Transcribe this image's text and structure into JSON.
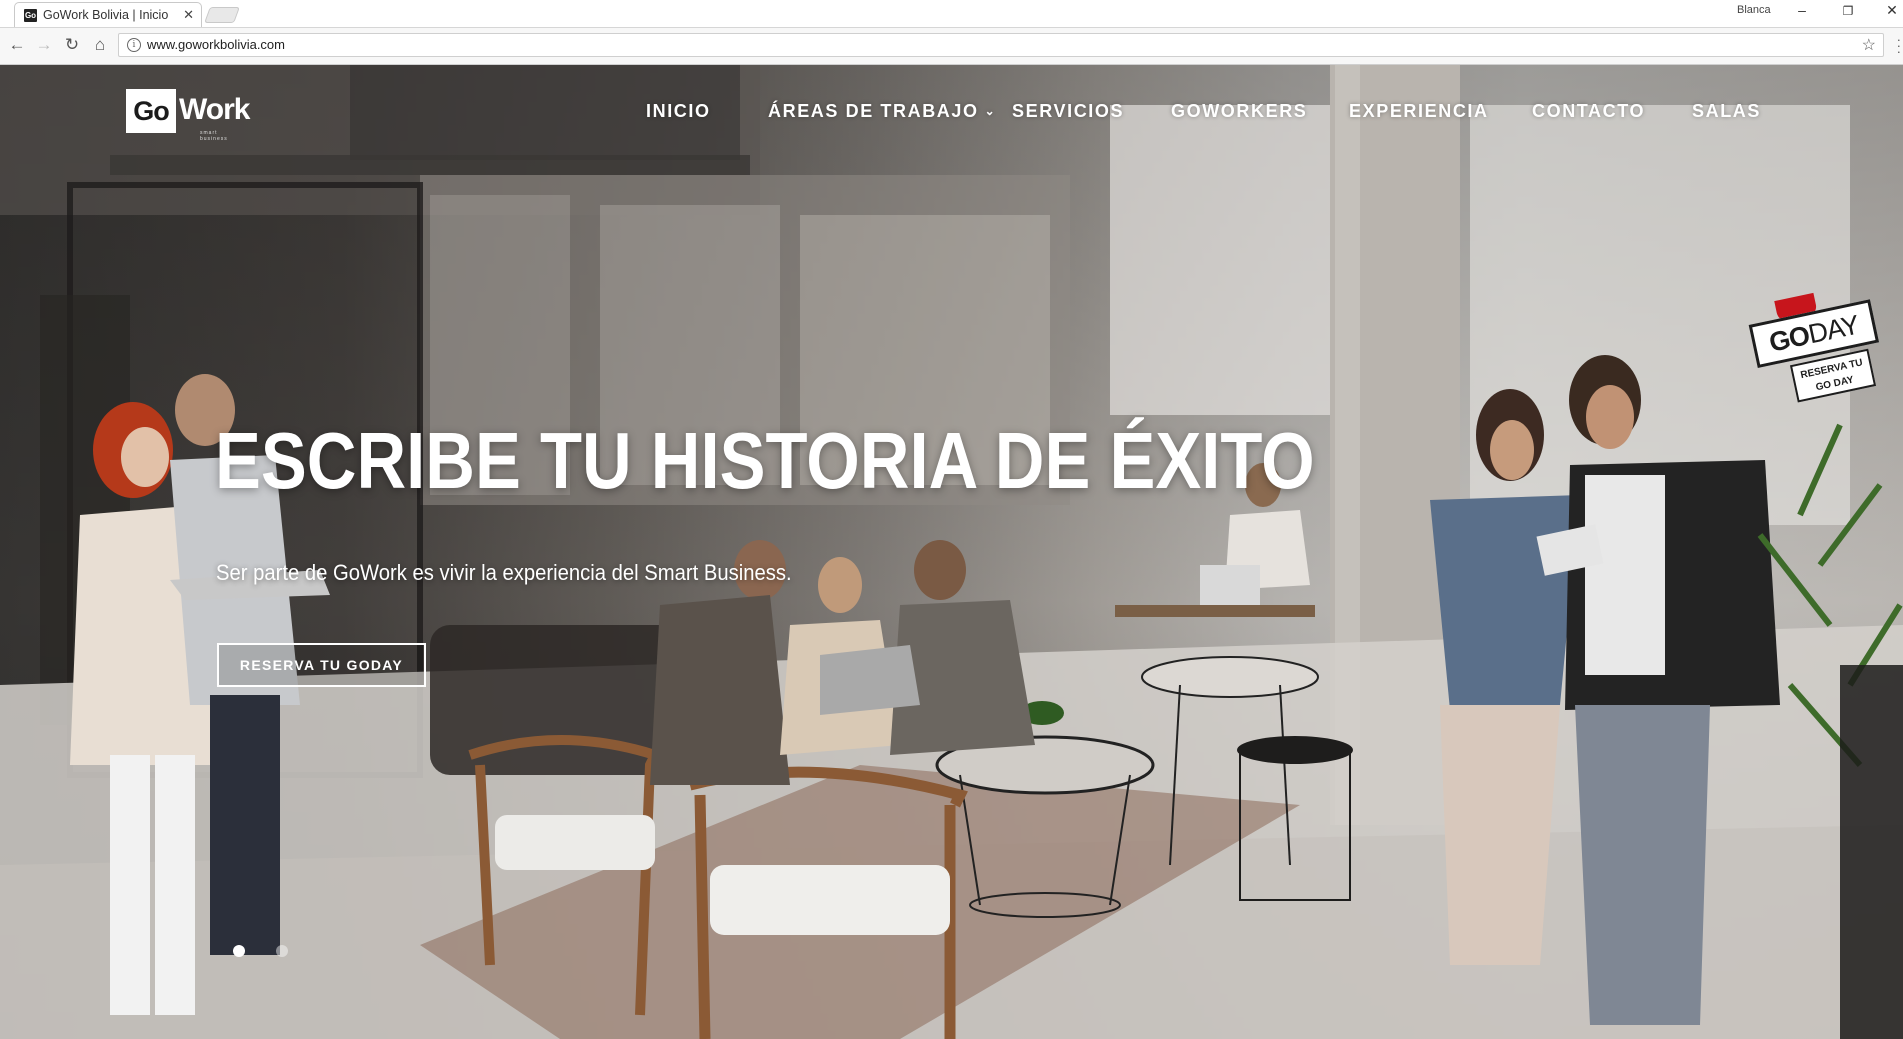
{
  "browser": {
    "tab_title": "GoWork Bolivia | Inicio",
    "favicon_text": "Go",
    "profile_name": "Blanca",
    "url": "www.goworkbolivia.com"
  },
  "site": {
    "logo": {
      "go": "Go",
      "work": "Work",
      "tagline": "smart business"
    },
    "nav": [
      {
        "label": "INICIO"
      },
      {
        "label": "ÁREAS DE TRABAJO",
        "has_dropdown": true
      },
      {
        "label": "SERVICIOS"
      },
      {
        "label": "GOWORKERS"
      },
      {
        "label": "EXPERIENCIA"
      },
      {
        "label": "CONTACTO"
      },
      {
        "label": "SALAS"
      }
    ],
    "hero": {
      "headline": "ESCRIBE TU HISTORIA DE ÉXITO",
      "subheadline": "Ser parte de GoWork es vivir la experiencia del Smart Business.",
      "cta_label": "RESERVA TU GODAY",
      "slide_count": 2,
      "active_slide": 1
    },
    "goday_badge": {
      "go": "GO",
      "day": "DAY",
      "label_line1": "RESERVA TU",
      "label_line2": "GO DAY"
    }
  },
  "colors": {
    "badge_red": "#c7151c",
    "text_white": "#ffffff"
  }
}
